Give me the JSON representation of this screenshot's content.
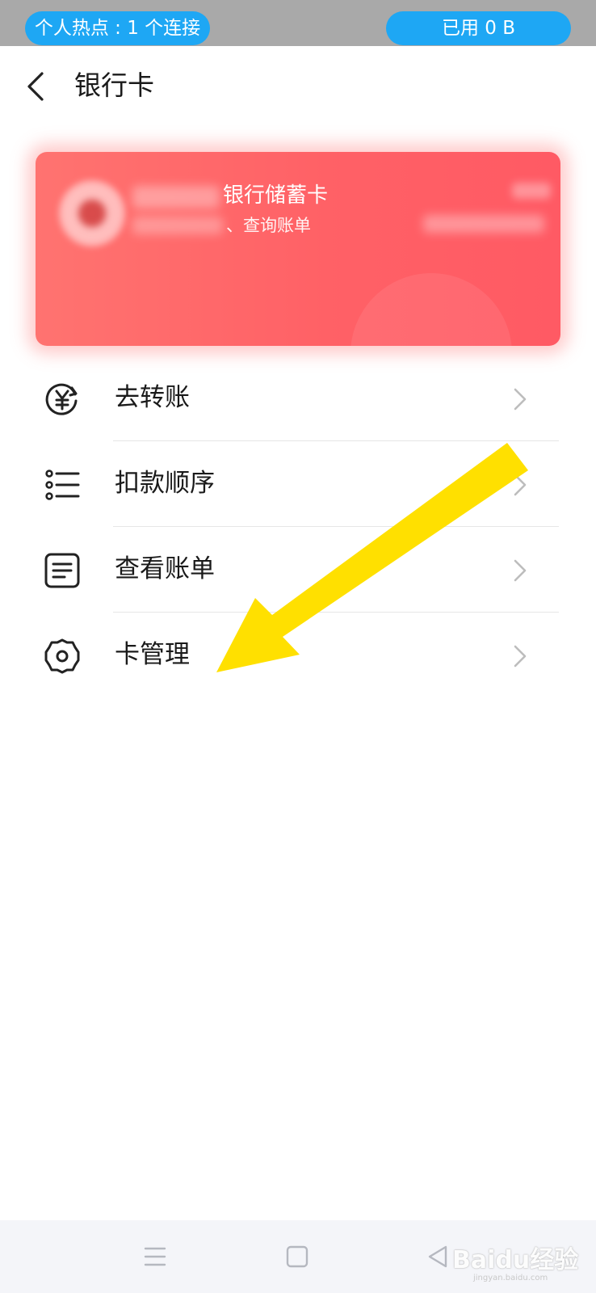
{
  "status_bar": {
    "hotspot_text": "个人热点 : 1 个连接",
    "data_usage_text": "已用 0 B"
  },
  "header": {
    "title": "银行卡"
  },
  "card": {
    "name": "银行储蓄卡",
    "description": "、查询账单",
    "accent_color": "#ff6166"
  },
  "menu": {
    "items": [
      {
        "label": "去转账",
        "icon": "yuan-transfer-icon"
      },
      {
        "label": "扣款顺序",
        "icon": "list-icon"
      },
      {
        "label": "查看账单",
        "icon": "document-icon"
      },
      {
        "label": "卡管理",
        "icon": "gear-icon"
      }
    ]
  },
  "annotation": {
    "color": "#ffe000",
    "target": "卡管理"
  },
  "nav_bar": {
    "watermark": "Baidu经验",
    "watermark_url": "jingyan.baidu.com"
  }
}
